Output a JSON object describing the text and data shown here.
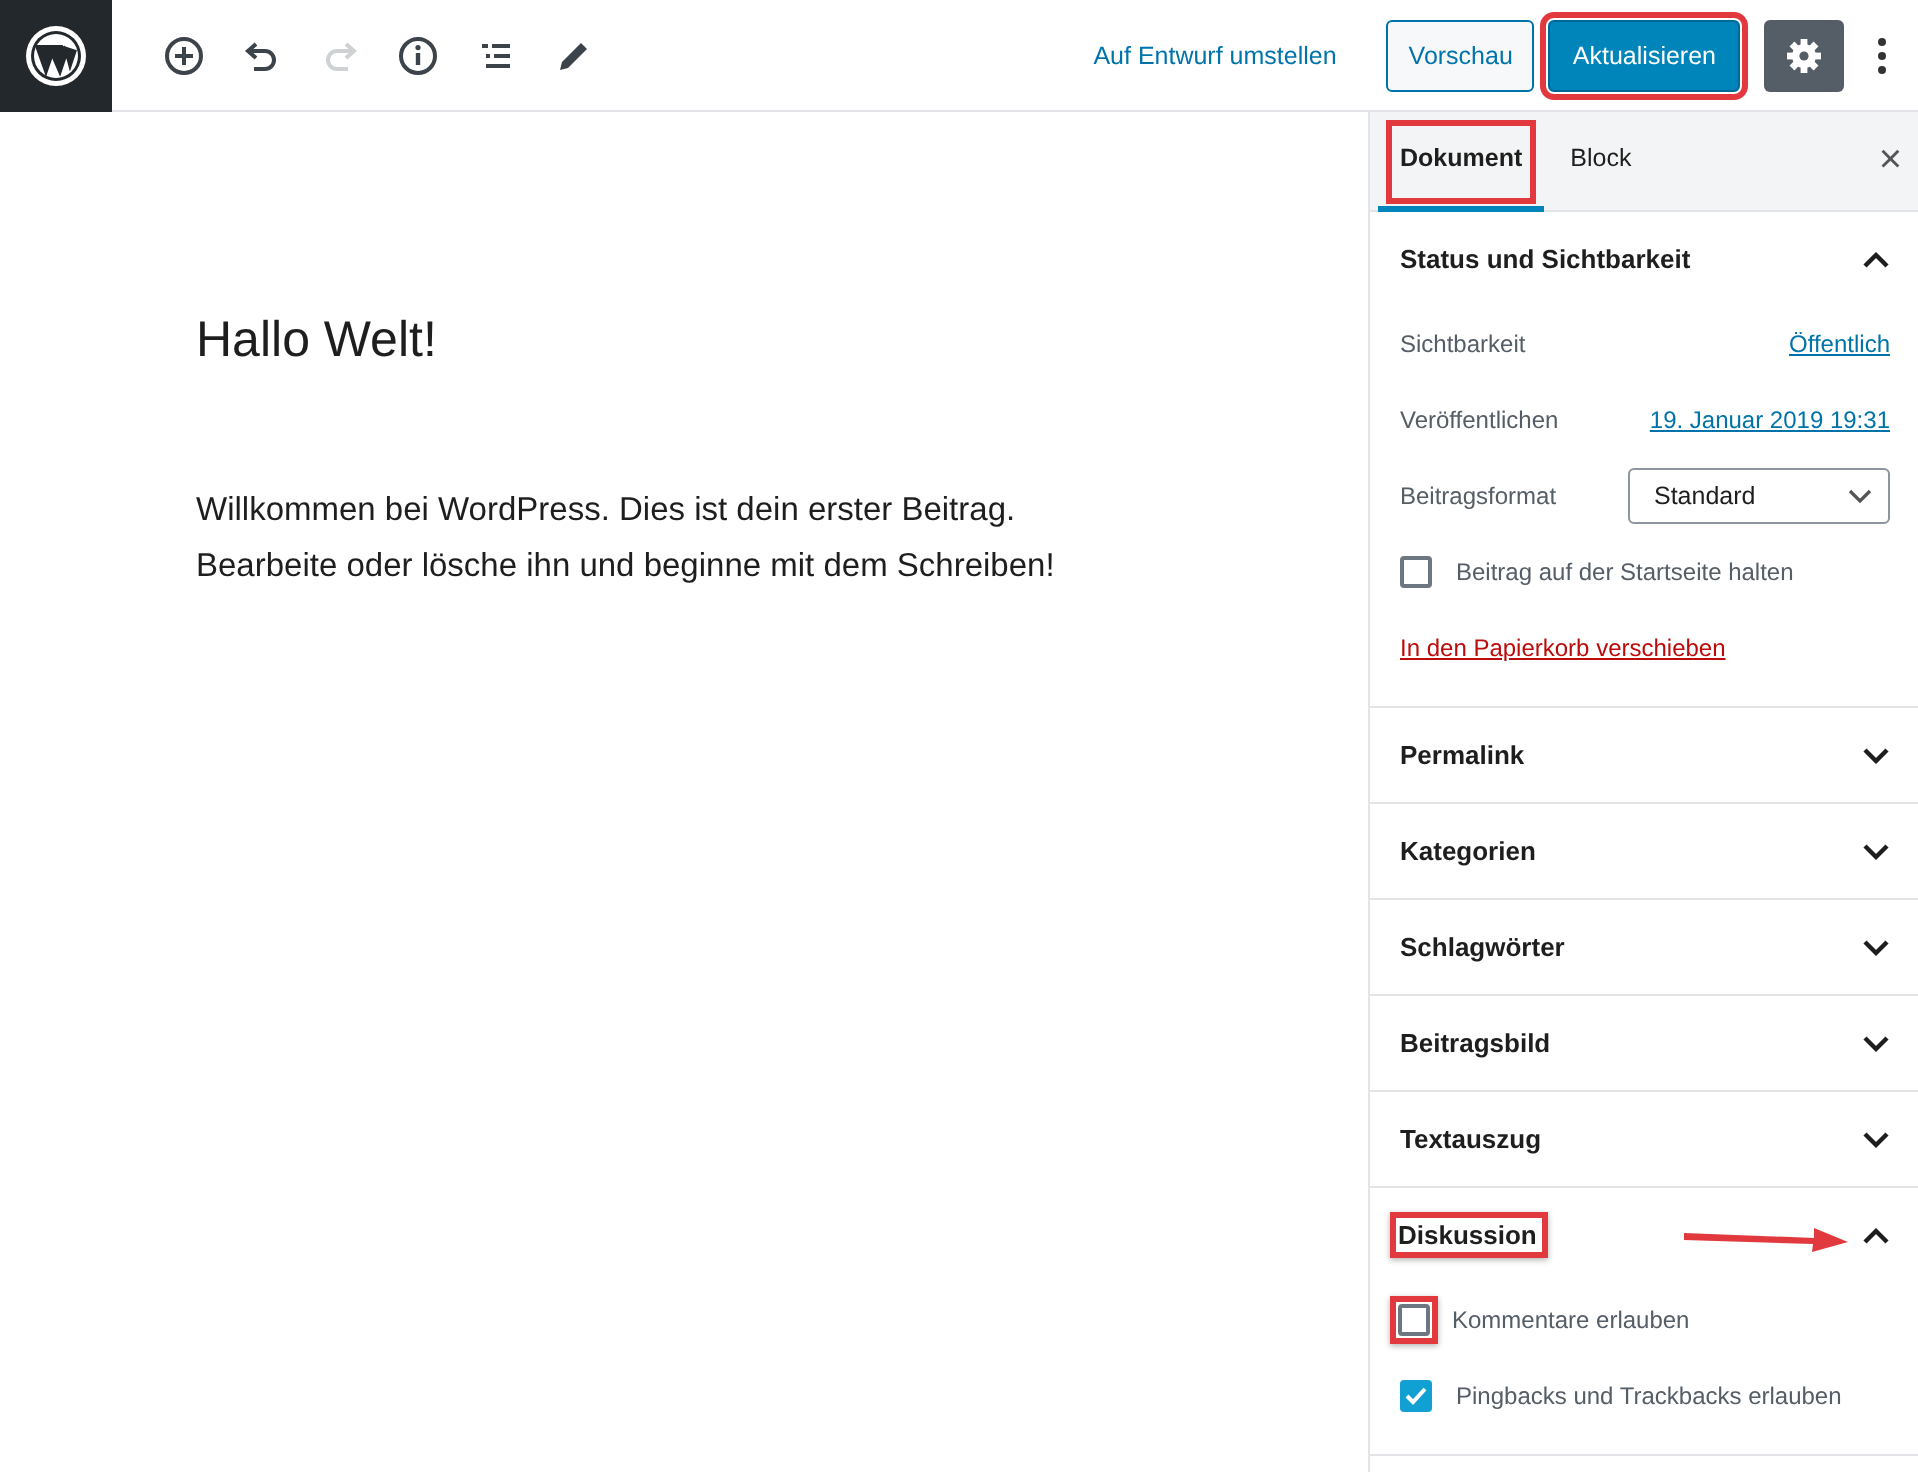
{
  "toolbar": {
    "tools": [
      {
        "kind": "add",
        "disabled": false
      },
      {
        "kind": "undo",
        "disabled": false
      },
      {
        "kind": "redo",
        "disabled": true
      },
      {
        "kind": "info",
        "disabled": false
      },
      {
        "kind": "outline",
        "disabled": false
      },
      {
        "kind": "edit",
        "disabled": false
      }
    ],
    "draft_link": "Auf Entwurf umstellen",
    "preview_button": "Vorschau",
    "update_button": {
      "label": "Aktualisieren",
      "highlighted": true
    },
    "settings_button": {
      "selected": true
    }
  },
  "editor": {
    "title": "Hallo Welt!",
    "paragraph": "Willkommen bei WordPress. Dies ist dein erster Beitrag. Bearbeite oder lösche ihn und beginne mit dem Schreiben!"
  },
  "sidebar": {
    "tabs": [
      {
        "label": "Dokument",
        "selected": true,
        "highlighted": true
      },
      {
        "label": "Block",
        "selected": false,
        "highlighted": false
      }
    ],
    "close": "×",
    "panels": [
      {
        "title": "Status und Sichtbarkeit",
        "expanded": true,
        "highlighted": false,
        "arrow": false,
        "rows": [
          {
            "kind": "link",
            "label": "Sichtbarkeit",
            "value": "Öffentlich"
          },
          {
            "kind": "link",
            "label": "Veröffentlichen",
            "value": "19. Januar 2019 19:31"
          },
          {
            "kind": "select",
            "label": "Beitragsformat",
            "value": "Standard"
          },
          {
            "kind": "checkbox",
            "label": "Beitrag auf der Startseite halten",
            "checked": false,
            "highlighted": false
          },
          {
            "kind": "danger",
            "label": "In den Papierkorb verschieben"
          }
        ]
      },
      {
        "title": "Permalink",
        "expanded": false,
        "highlighted": false,
        "arrow": false
      },
      {
        "title": "Kategorien",
        "expanded": false,
        "highlighted": false,
        "arrow": false
      },
      {
        "title": "Schlagwörter",
        "expanded": false,
        "highlighted": false,
        "arrow": false
      },
      {
        "title": "Beitragsbild",
        "expanded": false,
        "highlighted": false,
        "arrow": false
      },
      {
        "title": "Textauszug",
        "expanded": false,
        "highlighted": false,
        "arrow": false
      },
      {
        "title": "Diskussion",
        "expanded": true,
        "highlighted": true,
        "arrow": true,
        "rows": [
          {
            "kind": "checkbox",
            "label": "Kommentare erlauben",
            "checked": false,
            "highlighted": true
          },
          {
            "kind": "checkbox",
            "label": "Pingbacks und Trackbacks erlauben",
            "checked": true,
            "highlighted": false
          }
        ]
      }
    ]
  }
}
